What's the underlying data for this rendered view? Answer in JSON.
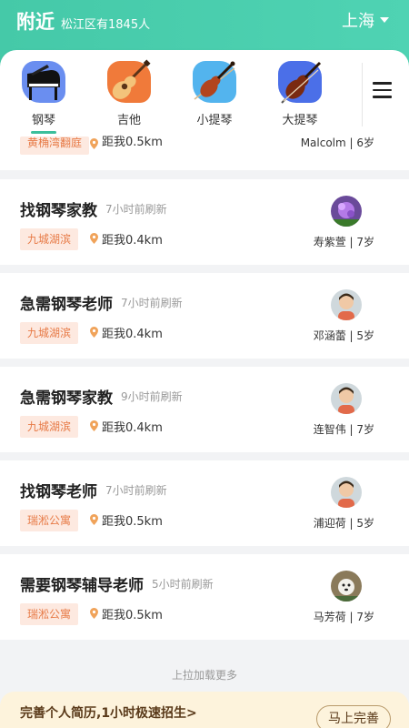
{
  "header": {
    "title": "附近",
    "subtitle": "松江区有1845人",
    "city": "上海"
  },
  "categories": [
    {
      "label": "钢琴",
      "icon": "piano-icon",
      "selected": true,
      "color": "#6a8ef0"
    },
    {
      "label": "吉他",
      "icon": "guitar-icon",
      "selected": false,
      "color": "#f07a3a"
    },
    {
      "label": "小提琴",
      "icon": "violin-icon",
      "selected": false,
      "color": "#53b4ee"
    },
    {
      "label": "大提琴",
      "icon": "cello-icon",
      "selected": false,
      "color": "#4b6fe8"
    }
  ],
  "menu_icon": "menu-icon",
  "partial_card": {
    "location": "黄桷湾翻庭",
    "distance": "距我0.5km",
    "child": "Malcolm | 6岁"
  },
  "cards": [
    {
      "job": "找钢琴家教",
      "time": "7小时前刷新",
      "location": "九城湖滨",
      "distance": "距我0.4km",
      "child": "寿紫萱 | 7岁",
      "avatar": "flower-avatar"
    },
    {
      "job": "急需钢琴老师",
      "time": "7小时前刷新",
      "location": "九城湖滨",
      "distance": "距我0.4km",
      "child": "邓涵蕾 | 5岁",
      "avatar": "child-avatar"
    },
    {
      "job": "急需钢琴家教",
      "time": "9小时前刷新",
      "location": "九城湖滨",
      "distance": "距我0.4km",
      "child": "连智伟 | 7岁",
      "avatar": "child-avatar"
    },
    {
      "job": "找钢琴老师",
      "time": "7小时前刷新",
      "location": "瑞淞公寓",
      "distance": "距我0.5km",
      "child": "浦迎荷 | 5岁",
      "avatar": "child-avatar"
    },
    {
      "job": "需要钢琴辅导老师",
      "time": "5小时前刷新",
      "location": "瑞淞公寓",
      "distance": "距我0.5km",
      "child": "马芳荷 | 7岁",
      "avatar": "dog-avatar"
    }
  ],
  "footer": {
    "load_more": "上拉加载更多",
    "banner_text": "完善个人简历,1小时极速招生>",
    "banner_button": "马上完善"
  }
}
